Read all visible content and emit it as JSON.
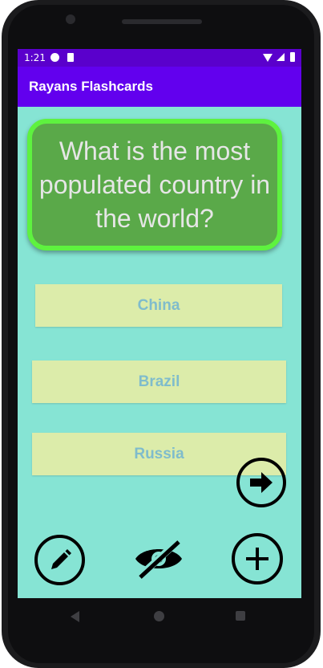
{
  "status": {
    "time": "1:21"
  },
  "app_bar": {
    "title": "Rayans Flashcards"
  },
  "question": {
    "text": "What is the most populated country in the world?"
  },
  "answers": [
    {
      "label": "China"
    },
    {
      "label": "Brazil"
    },
    {
      "label": "Russia"
    }
  ],
  "icons": {
    "next": "arrow-right-circle-icon",
    "edit": "pencil-circle-icon",
    "toggle": "eye-off-icon",
    "add": "plus-circle-icon"
  },
  "colors": {
    "status_bar": "#5a00cc",
    "app_bar": "#6200ee",
    "background": "#86e4d4",
    "question_card": "#5aa949",
    "question_border": "#5ef23f",
    "answer_bg": "#dcecaa",
    "answer_text": "#7fbccc"
  }
}
